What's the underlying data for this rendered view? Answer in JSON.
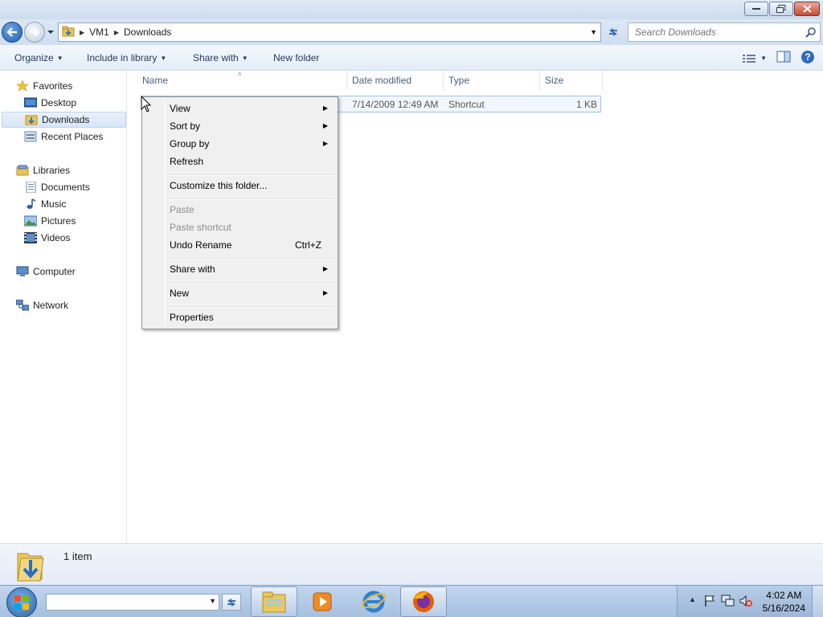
{
  "window": {
    "breadcrumbs": [
      "VM1",
      "Downloads"
    ],
    "search_placeholder": "Search Downloads"
  },
  "toolbar": {
    "organize": "Organize",
    "include_in_library": "Include in library",
    "share_with": "Share with",
    "new_folder": "New folder"
  },
  "sidebar": {
    "favorites": "Favorites",
    "desktop": "Desktop",
    "downloads": "Downloads",
    "recent_places": "Recent Places",
    "libraries": "Libraries",
    "documents": "Documents",
    "music": "Music",
    "pictures": "Pictures",
    "videos": "Videos",
    "computer": "Computer",
    "network": "Network"
  },
  "columns": {
    "name": "Name",
    "date_modified": "Date modified",
    "type": "Type",
    "size": "Size"
  },
  "files": [
    {
      "date": "7/14/2009 12:49 AM",
      "type": "Shortcut",
      "size": "1 KB"
    }
  ],
  "context_menu": {
    "view": "View",
    "sort_by": "Sort by",
    "group_by": "Group by",
    "refresh": "Refresh",
    "customize": "Customize this folder...",
    "paste": "Paste",
    "paste_shortcut": "Paste shortcut",
    "undo_rename": "Undo Rename",
    "undo_shortcut": "Ctrl+Z",
    "share_with": "Share with",
    "new": "New",
    "properties": "Properties"
  },
  "details": {
    "item_count": "1 item"
  },
  "taskbar": {
    "time": "4:02 AM",
    "date": "5/16/2024"
  },
  "colors": {
    "accent": "#3a78c9",
    "selection": "#d7e6f8",
    "menu_bg": "#f0f0f0"
  }
}
